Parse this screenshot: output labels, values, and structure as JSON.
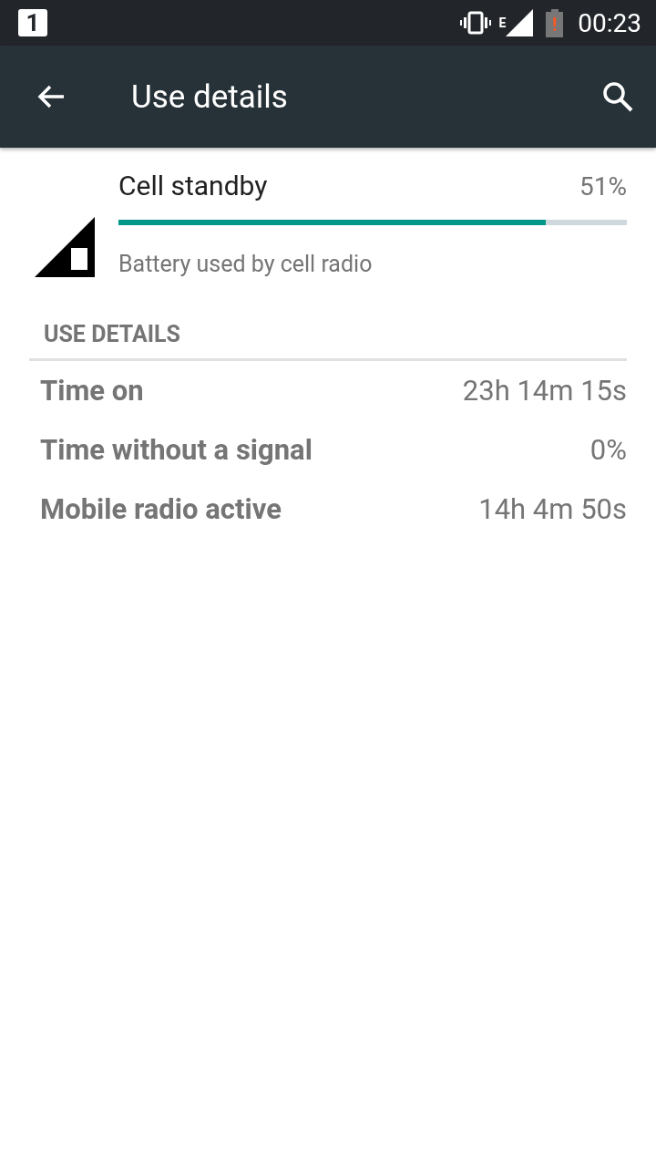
{
  "status_bar": {
    "notification_number": "1",
    "network_type": "E",
    "battery_alert": "!",
    "time": "00:23"
  },
  "app_bar": {
    "title": "Use details"
  },
  "summary": {
    "title": "Cell standby",
    "percent": "51%",
    "level": 0.84,
    "subtitle": "Battery used by cell radio"
  },
  "section": {
    "header": "USE DETAILS",
    "rows": [
      {
        "label": "Time on",
        "value": "23h 14m 15s"
      },
      {
        "label": "Time without a signal",
        "value": "0%"
      },
      {
        "label": "Mobile radio active",
        "value": "14h 4m 50s"
      }
    ]
  }
}
